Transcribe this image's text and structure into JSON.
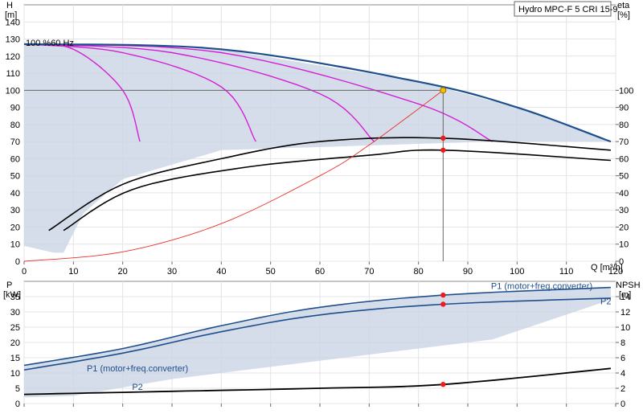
{
  "chart_data": [
    {
      "type": "line",
      "title": "Hydro MPC-F 5 CRI 15-9",
      "ylabel_left": "H",
      "ylabel_left_unit": "[m]",
      "ylabel_right": "eta",
      "ylabel_right_unit": "[%]",
      "xlabel": "Q [m³/h]",
      "xlim": [
        0,
        120
      ],
      "ylim": [
        0,
        150
      ],
      "eta_lim": [
        0,
        100
      ],
      "x_ticks": [
        "0",
        "10",
        "20",
        "30",
        "40",
        "50",
        "60",
        "70",
        "80",
        "90",
        "100",
        "110",
        "120"
      ],
      "y_ticks": [
        "0",
        "10",
        "20",
        "30",
        "40",
        "50",
        "60",
        "70",
        "80",
        "90",
        "100",
        "110",
        "120",
        "130",
        "140"
      ],
      "eta_ticks": [
        "0",
        "10",
        "20",
        "30",
        "40",
        "50",
        "60",
        "70",
        "80",
        "90",
        "100"
      ],
      "annotation": "100 %60 Hz",
      "grid": true,
      "duty_point": {
        "q": 85,
        "h": 100
      },
      "operating_markers": [
        {
          "q": 85,
          "value": 72,
          "axis": "eta"
        },
        {
          "q": 85,
          "value": 65,
          "axis": "eta"
        }
      ],
      "series": [
        {
          "role": "qh_1_pump",
          "color": "#d61fd6",
          "points": [
            [
              0,
              127
            ],
            [
              10,
              124
            ],
            [
              20,
              100
            ],
            [
              23.5,
              70
            ]
          ]
        },
        {
          "role": "qh_2_pumps",
          "color": "#d61fd6",
          "points": [
            [
              0,
              127
            ],
            [
              20,
              122
            ],
            [
              40,
              102
            ],
            [
              47,
              70
            ]
          ]
        },
        {
          "role": "qh_3_pumps",
          "color": "#d61fd6",
          "points": [
            [
              0,
              127
            ],
            [
              30,
              122
            ],
            [
              60,
              98
            ],
            [
              71,
              70
            ]
          ]
        },
        {
          "role": "qh_4_pumps",
          "color": "#d61fd6",
          "points": [
            [
              0,
              127
            ],
            [
              40,
              122
            ],
            [
              80,
              92
            ],
            [
              95,
              70
            ]
          ]
        },
        {
          "role": "qh_5_pumps_max",
          "color": "#1f4e8c",
          "points": [
            [
              0,
              127
            ],
            [
              40,
              124
            ],
            [
              80,
              105
            ],
            [
              100,
              90
            ],
            [
              119,
              70
            ]
          ]
        },
        {
          "role": "eta_operating",
          "color": "#000000",
          "points": [
            [
              5,
              18
            ],
            [
              20,
              45
            ],
            [
              40,
              60
            ],
            [
              60,
              70
            ],
            [
              85,
              72
            ],
            [
              119,
              65
            ]
          ]
        },
        {
          "role": "eta_operating_2",
          "color": "#000000",
          "points": [
            [
              8,
              18
            ],
            [
              22,
              42
            ],
            [
              45,
              55
            ],
            [
              70,
              62
            ],
            [
              85,
              65
            ],
            [
              119,
              59
            ]
          ]
        },
        {
          "role": "system_curve",
          "color": "#e8302b",
          "points": [
            [
              0,
              0
            ],
            [
              20,
              5.5
            ],
            [
              40,
              22
            ],
            [
              60,
              50
            ],
            [
              70,
              68
            ],
            [
              85,
              100
            ]
          ]
        }
      ]
    },
    {
      "type": "line",
      "ylabel_left": "P",
      "ylabel_left_unit": "[kW]",
      "ylabel_right": "NPSH",
      "ylabel_right_unit": "[m]",
      "xlim": [
        0,
        120
      ],
      "ylim": [
        0,
        40
      ],
      "npsh_lim": [
        0,
        16
      ],
      "y_ticks": [
        "0",
        "5",
        "10",
        "15",
        "20",
        "25",
        "30",
        "35"
      ],
      "npsh_ticks": [
        "0",
        "2",
        "4",
        "6",
        "8",
        "10",
        "12",
        "14"
      ],
      "grid": true,
      "labels": [
        {
          "text": "P1 (motor+freq.converter)",
          "q": 105,
          "p": 37.5,
          "color": "#1f4e8c"
        },
        {
          "text": "P2",
          "q": 118,
          "p": 32.5,
          "color": "#1f4e8c"
        },
        {
          "text": "P1 (motor+freq.converter)",
          "q": 23,
          "p": 10.5,
          "color": "#1f4e8c"
        },
        {
          "text": "P2",
          "q": 23,
          "p": 4.5,
          "color": "#1f4e8c"
        }
      ],
      "operating_markers": [
        {
          "q": 85,
          "value": 35.5,
          "axis": "p"
        },
        {
          "q": 85,
          "value": 32.5,
          "axis": "p"
        },
        {
          "q": 85,
          "value": 2.5,
          "axis": "npsh"
        }
      ],
      "series": [
        {
          "role": "p1_max",
          "color": "#1f4e8c",
          "points": [
            [
              0,
              12.5
            ],
            [
              20,
              18
            ],
            [
              40,
              25.5
            ],
            [
              60,
              31.5
            ],
            [
              85,
              35.5
            ],
            [
              119,
              38
            ]
          ]
        },
        {
          "role": "p2_max",
          "color": "#1f4e8c",
          "points": [
            [
              0,
              11
            ],
            [
              20,
              16.5
            ],
            [
              40,
              23.5
            ],
            [
              60,
              29
            ],
            [
              85,
              32.5
            ],
            [
              119,
              34.5
            ]
          ]
        },
        {
          "role": "npsh",
          "color": "#000000",
          "points": [
            [
              0,
              1.2
            ],
            [
              30,
              1.6
            ],
            [
              60,
              2.0
            ],
            [
              85,
              2.5
            ],
            [
              119,
              4.6
            ]
          ]
        }
      ]
    }
  ]
}
